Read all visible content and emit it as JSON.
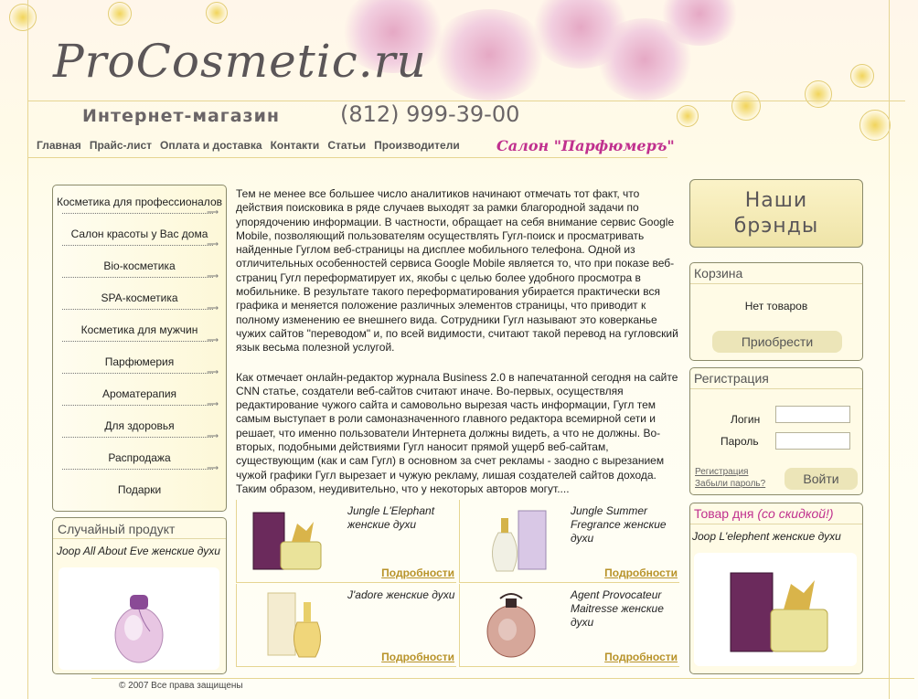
{
  "header": {
    "logo": "ProCosmetic.ru",
    "tagline": "Интернет-магазин",
    "phone": "(812) 999-39-00",
    "salon": "Салон \"Парфюмеръ\""
  },
  "nav": [
    "Главная",
    "Прайс-лист",
    "Оплата и доставка",
    "Контакти",
    "Статьи",
    "Производители"
  ],
  "menu": [
    "Косметика для профессионалов",
    "Салон красоты у Вас дома",
    "Bio-косметика",
    "SPA-косметика",
    "Косметика для мужчин",
    "Парфюмерия",
    "Ароматерапия",
    "Для здоровья",
    "Распродажа",
    "Подарки"
  ],
  "random": {
    "title": "Случайный продукт",
    "name": "Joop All About Eve женские духи"
  },
  "article": {
    "p1": "Тем не менее все большее число аналитиков начинают отмечать тот факт, что действия поисковика в ряде случаев выходят за рамки благородной задачи по упорядочению информации. В частности, обращает на себя внимание сервис Google Mobile, позволяющий пользователям осуществлять Гугл-поиск и просматривать найденные Гуглом веб-страницы на дисплее мобильного телефона. Одной из отличительных особенностей сервиса Google Mobile является то, что при показе веб-страниц Гугл переформатирует их, якобы с целью более удобного просмотра в мобильнике. В результате такого переформатирования убирается практически вся графика и меняется положение различных элементов страницы, что приводит к полному изменению ее внешнего вида. Сотрудники Гугл называют это коверканье чужих сайтов \"переводом\" и, по всей видимости, считают такой перевод на гугловский язык весьма полезной услугой.",
    "p2": "Как отмечает онлайн-редактор журнала Business 2.0 в напечатанной сегодня на сайте CNN статье, создатели веб-сайтов считают иначе. Во-первых, осуществляя редактирование чужого сайта и самовольно вырезая часть информации, Гугл тем самым выступает в роли самоназначенного главного редактора всемирной сети и решает, что именно пользователи Интернета должны видеть, а что не должны. Во-вторых, подобными действиями Гугл наносит прямой ущерб веб-сайтам, существующим (как и сам Гугл) в основном за счет рекламы - заодно с вырезанием чужой графики Гугл вырезает и чужую рекламу, лишая создателей сайтов дохода. Таким образом, неудивительно, что у некоторых авторов могут...."
  },
  "products": [
    {
      "name": "Jungle L'Elephant женские духи",
      "more": "Подробности"
    },
    {
      "name": "Jungle Summer Fregrance женские духи",
      "more": "Подробности"
    },
    {
      "name": "J'adore женские духи",
      "more": "Подробности"
    },
    {
      "name": "Agent Provocateur Maitresse женские духи",
      "more": "Подробности"
    }
  ],
  "brands": {
    "line1": "Наши",
    "line2": "брэнды"
  },
  "cart": {
    "title": "Корзина",
    "empty": "Нет товаров",
    "button": "Приобрести"
  },
  "register": {
    "title": "Регистрация",
    "login_label": "Логин",
    "password_label": "Пароль",
    "login_value": "",
    "password_value": "",
    "register_link": "Регистрация",
    "forgot_link": "Забыли пароль?",
    "button": "Войти"
  },
  "deal": {
    "title": "Товар дня",
    "title_note": "(со скидкой!)",
    "name": "Joop L'elephent  женские духи"
  },
  "footer": "© 2007 Все права защищены",
  "colors": {
    "accent_pink": "#c0308e",
    "link_gold": "#b8932a",
    "border": "#8a8a6a"
  }
}
